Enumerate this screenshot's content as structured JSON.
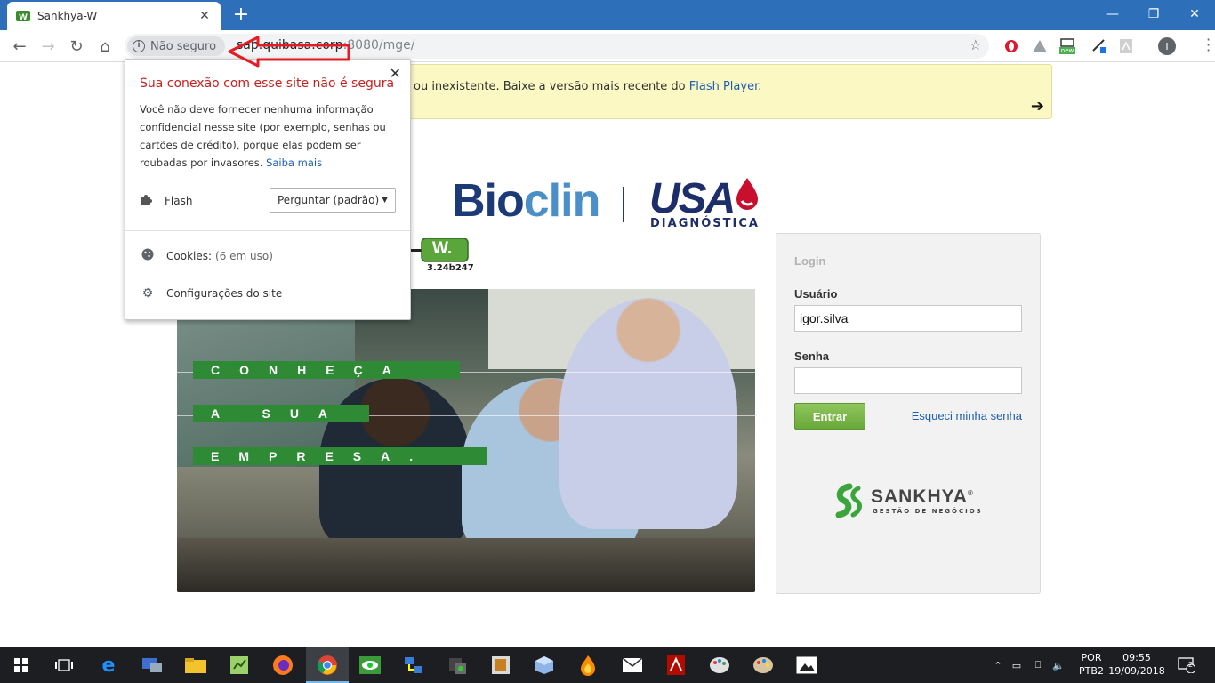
{
  "browser": {
    "tab_title": "Sankhya-W",
    "new_tab_label": "+",
    "window_controls": [
      "—",
      "❐",
      "✕"
    ],
    "security_chip": "Não seguro",
    "url_host": "sap.quibasa.corp",
    "url_port": ":8080",
    "url_path": "/mge/",
    "extension_badge": "new"
  },
  "flash_banner": {
    "text": "ou inexistente. Baixe a versão mais recente do ",
    "link": "Flash Player",
    "suffix": ".",
    "arrow": "➔"
  },
  "brand": {
    "bioclin_a": "Bio",
    "bioclin_b": "clin",
    "usa": "USA",
    "diagnostica": "DIAGNÓSTICA",
    "version": "3.24b247",
    "sankhya_w": "W."
  },
  "photo": {
    "slogan": [
      "CONHEÇA",
      "A SUA",
      "EMPRESA."
    ]
  },
  "login": {
    "title": "Login",
    "user_label": "Usuário",
    "user_value": "igor.silva",
    "password_label": "Senha",
    "submit": "Entrar",
    "forgot": "Esqueci minha senha",
    "logo_name": "SANKHYA",
    "logo_sub": "GESTÃO DE NEGÓCIOS",
    "logo_reg": "®"
  },
  "popup": {
    "heading": "Sua conexão com esse site não é segura",
    "body": "Você não deve fornecer nenhuma informação confidencial nesse site (por exemplo, senhas ou cartões de crédito), porque elas podem ser roubadas por invasores. ",
    "learn_more": "Saiba mais",
    "flash_label": "Flash",
    "flash_option": "Perguntar (padrão)",
    "cookies_label": "Cookies:",
    "cookies_sub": "(6 em uso)",
    "site_settings": "Configurações do site"
  },
  "taskbar": {
    "lang_top": "POR",
    "lang_bottom": "PTB2",
    "time": "09:55",
    "date": "19/09/2018",
    "notification_count": "2"
  },
  "colors": {
    "chrome_blue": "#2e6fb9",
    "warning_red": "#c5221f",
    "link_blue": "#1a5db3",
    "entrar_green": "#6aa83a"
  }
}
